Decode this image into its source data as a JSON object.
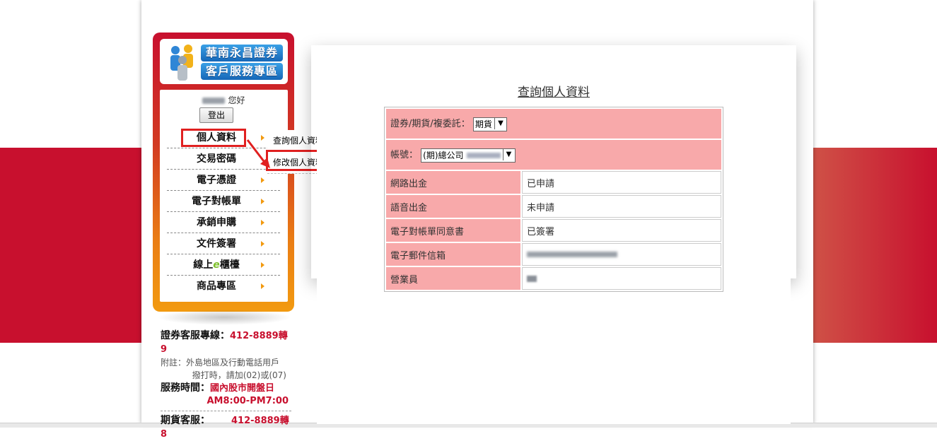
{
  "sidebar": {
    "logo_line1": "華南永昌證券",
    "logo_line2": "客戶服務專區",
    "greeting": "您好",
    "logout_label": "登出",
    "menu": [
      {
        "label": "個人資料"
      },
      {
        "label": "交易密碼"
      },
      {
        "label": "電子憑證"
      },
      {
        "label": "電子對帳單"
      },
      {
        "label": "承銷申購"
      },
      {
        "label": "文件簽署"
      },
      {
        "label_pre": "線上",
        "label_e": "e",
        "label_post": "櫃檯"
      },
      {
        "label": "商品專區"
      }
    ],
    "submenu": [
      {
        "label": "查詢個人資料"
      },
      {
        "label": "修改個人資料"
      }
    ]
  },
  "contact": {
    "securities_label": "證券客服專線：",
    "securities_phone": "412-8889轉9",
    "note_line1": "附註：外島地區及行動電話用戶",
    "note_line2": "撥打時，請加(02)或(07)",
    "hours_label": "服務時間：",
    "hours_value1": "國內股市開盤日",
    "hours_value2": "AM8:00-PM7:00",
    "futures_label": "期貨客服：",
    "futures_phone": "412-8889轉8"
  },
  "main": {
    "title": "查詢個人資料",
    "type_label": "證券/期貨/複委託：",
    "type_selected": "期貨",
    "account_label": "帳號：",
    "account_selected": "(期)總公司",
    "rows": [
      {
        "label": "網路出金",
        "value": "已申請"
      },
      {
        "label": "語音出金",
        "value": "未申請"
      },
      {
        "label": "電子對帳單同意書",
        "value": "已簽署"
      },
      {
        "label": "電子郵件信箱",
        "value": ""
      },
      {
        "label": "營業員",
        "value": ""
      }
    ]
  },
  "colors": {
    "brand_red": "#c8102e",
    "panel_orange": "#f29a10",
    "table_pink": "#f8a9aa",
    "highlight_red": "#e02020"
  }
}
